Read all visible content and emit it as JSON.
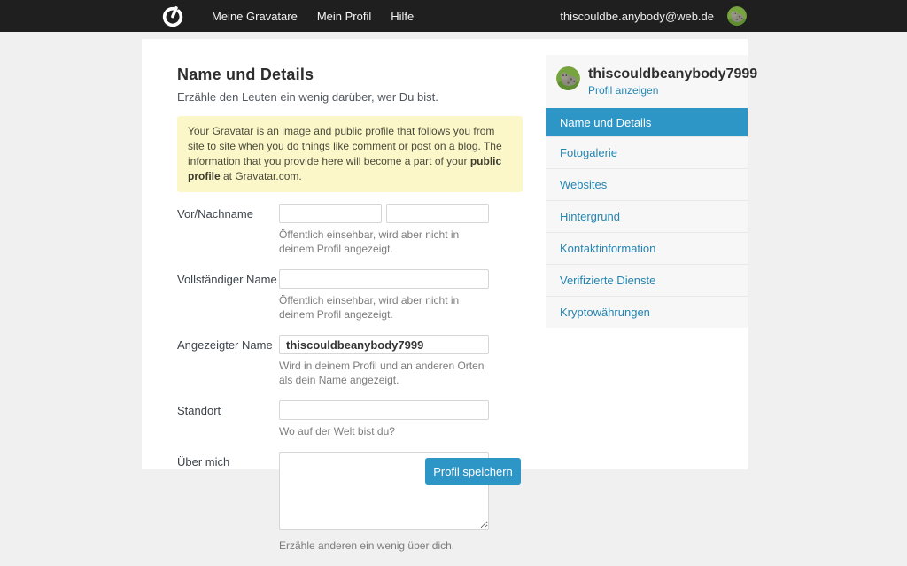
{
  "navbar": {
    "menu": [
      "Meine Gravatare",
      "Mein Profil",
      "Hilfe"
    ],
    "email": "thiscouldbe.anybody@web.de"
  },
  "main": {
    "title": "Name und Details",
    "subtitle": "Erzähle den Leuten ein wenig darüber, wer Du bist.",
    "notice": {
      "text_before": "Your Gravatar is an image and public profile that follows you from site to site when you do things like comment or post on a blog. The information that you provide here will become a part of your ",
      "bold": "public profile",
      "text_after": " at Gravatar.com."
    },
    "fields": {
      "name_row": {
        "label": "Vor/Nachname",
        "first_value": "",
        "last_value": "",
        "helper": "Öffentlich einsehbar, wird aber nicht in deinem Profil angezeigt."
      },
      "full_name": {
        "label": "Vollständiger Name",
        "value": "",
        "helper": "Öffentlich einsehbar, wird aber nicht in deinem Profil angezeigt."
      },
      "display_name": {
        "label": "Angezeigter Name",
        "value": "thiscouldbeanybody7999",
        "helper": "Wird in deinem Profil und an anderen Orten als dein Name angezeigt."
      },
      "location": {
        "label": "Standort",
        "value": "",
        "helper": "Wo auf der Welt bist du?"
      },
      "about": {
        "label": "Über mich",
        "value": "",
        "helper": "Erzähle anderen ein wenig über dich."
      }
    },
    "save_button": "Profil speichern"
  },
  "sidebar": {
    "username": "thiscouldbeanybody7999",
    "view_profile_label": "Profil anzeigen",
    "items": [
      {
        "label": "Name und Details",
        "active": true
      },
      {
        "label": "Fotogalerie",
        "active": false
      },
      {
        "label": "Websites",
        "active": false
      },
      {
        "label": "Hintergrund",
        "active": false
      },
      {
        "label": "Kontaktinformation",
        "active": false
      },
      {
        "label": "Verifizierte Dienste",
        "active": false
      },
      {
        "label": "Kryptowährungen",
        "active": false
      }
    ]
  },
  "colors": {
    "navbar_bg": "#1f1f1f",
    "accent_blue": "#2d96c7",
    "link_blue": "#2585b2",
    "notice_bg": "#fbf7c9",
    "page_bg": "#f0f0f0"
  }
}
